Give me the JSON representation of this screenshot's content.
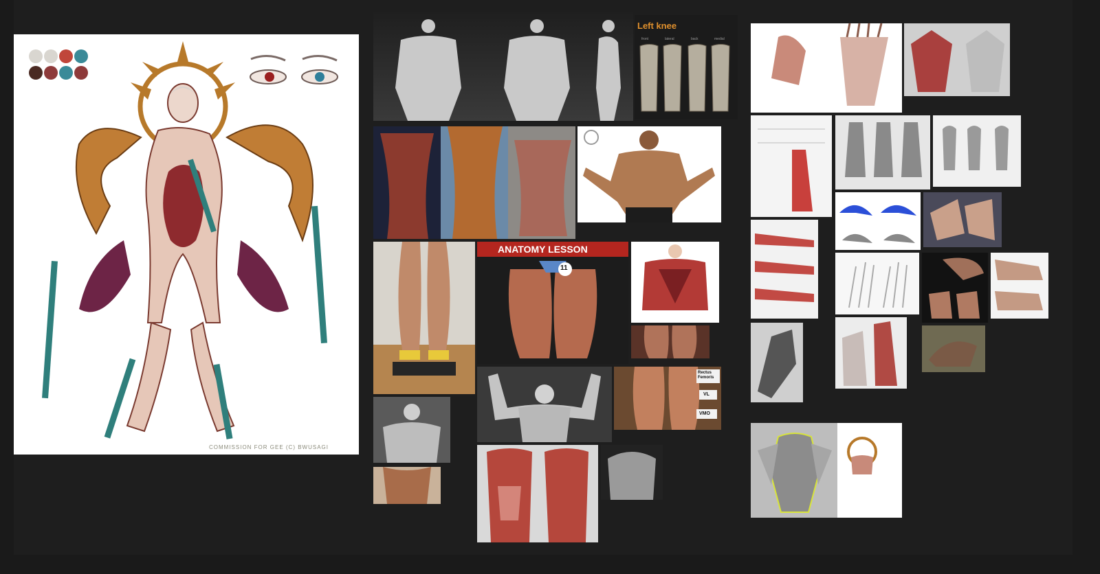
{
  "board": {
    "background": "#1e1e1e"
  },
  "character_sheet": {
    "credit": "COMMISSION FOR GEE (C) BWUSAGI",
    "palette": [
      "#d9d6d0",
      "#d9d6d0",
      "#c0463a",
      "#3a8a98",
      "#4a2a22",
      "#8e3a3a",
      "#3a8a98",
      "#8e3a3a"
    ],
    "accent_gold": "#b7792a",
    "accent_teal": "#2f7f7c",
    "flesh": "#e6c7b8",
    "muscle": "#8e2a2e"
  },
  "refs": {
    "left_knee": {
      "title": "Left knee",
      "views": [
        "front",
        "lateral",
        "back",
        "medial"
      ]
    },
    "anatomy_lesson": {
      "title": "ANATOMY LESSON",
      "badge": "11"
    },
    "legs_labels": {
      "labels": [
        "Rectus Femoris",
        "VL",
        "VMO"
      ]
    }
  },
  "icons": {
    "image": "photo-reference-icon"
  }
}
